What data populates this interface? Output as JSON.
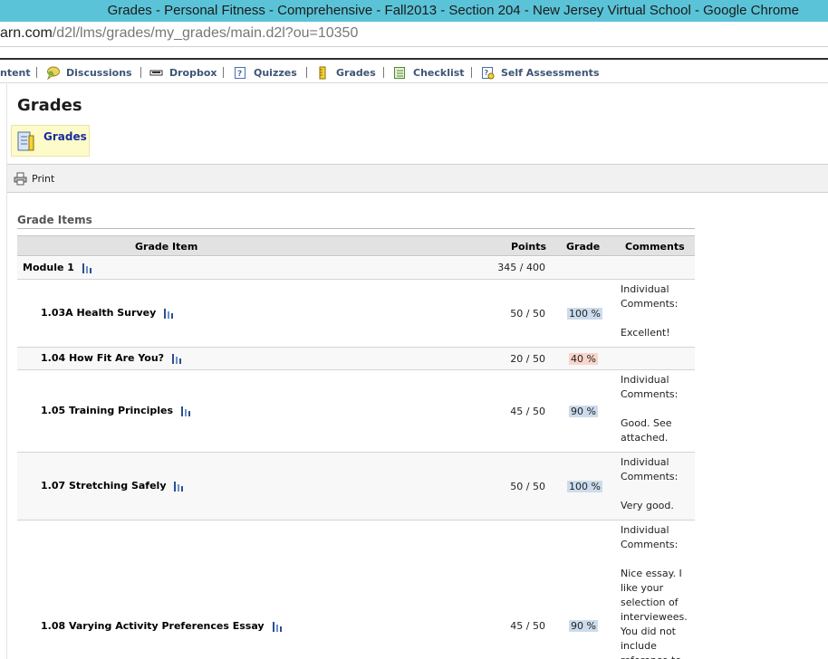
{
  "window": {
    "title": "Grades - Personal Fitness - Comprehensive - Fall2013 - Section 204 - New Jersey Virtual School - Google Chrome",
    "url_host": "arn.com",
    "url_path": "/d2l/lms/grades/my_grades/main.d2l?ou=10350"
  },
  "nav": {
    "items": [
      {
        "label": "ntent",
        "icon": "content-icon"
      },
      {
        "label": "Discussions",
        "icon": "speech-bubble-icon"
      },
      {
        "label": "Dropbox",
        "icon": "dropbox-icon"
      },
      {
        "label": "Quizzes",
        "icon": "quiz-icon"
      },
      {
        "label": "Grades",
        "icon": "ruler-icon"
      },
      {
        "label": "Checklist",
        "icon": "checklist-icon"
      },
      {
        "label": "Self Assessments",
        "icon": "self-assessment-icon"
      }
    ]
  },
  "page": {
    "title": "Grades",
    "grades_link": "Grades",
    "print_label": "Print",
    "section_title": "Grade Items"
  },
  "table": {
    "headers": {
      "item": "Grade Item",
      "points": "Points",
      "grade": "Grade",
      "comments": "Comments"
    },
    "rows": [
      {
        "name": "Module 1",
        "points": "345 / 400",
        "grade": "",
        "comment": ""
      },
      {
        "name": "1.03A Health Survey",
        "points": "50 / 50",
        "grade": "100 %",
        "comment": "Individual Comments:\n\nExcellent!"
      },
      {
        "name": "1.04 How Fit Are You?",
        "points": "20 / 50",
        "grade": "40 %",
        "comment": ""
      },
      {
        "name": "1.05 Training Principles",
        "points": "45 / 50",
        "grade": "90 %",
        "comment": "Individual Comments:\n\nGood. See attached."
      },
      {
        "name": "1.07 Stretching Safely",
        "points": "50 / 50",
        "grade": "100 %",
        "comment": "Individual Comments:\n\nVery good."
      },
      {
        "name": "1.08 Varying Activity Preferences Essay",
        "points": "45 / 50",
        "grade": "90 %",
        "comment": "Individual Comments:\n\nNice essay.  I like your selection of interviewees. You did not include reference to"
      }
    ]
  },
  "colors": {
    "title_bar": "#5ac3d8",
    "grade_good": "#ccdcec",
    "grade_bad": "#f8d5cc",
    "link": "#1a2c9d"
  }
}
